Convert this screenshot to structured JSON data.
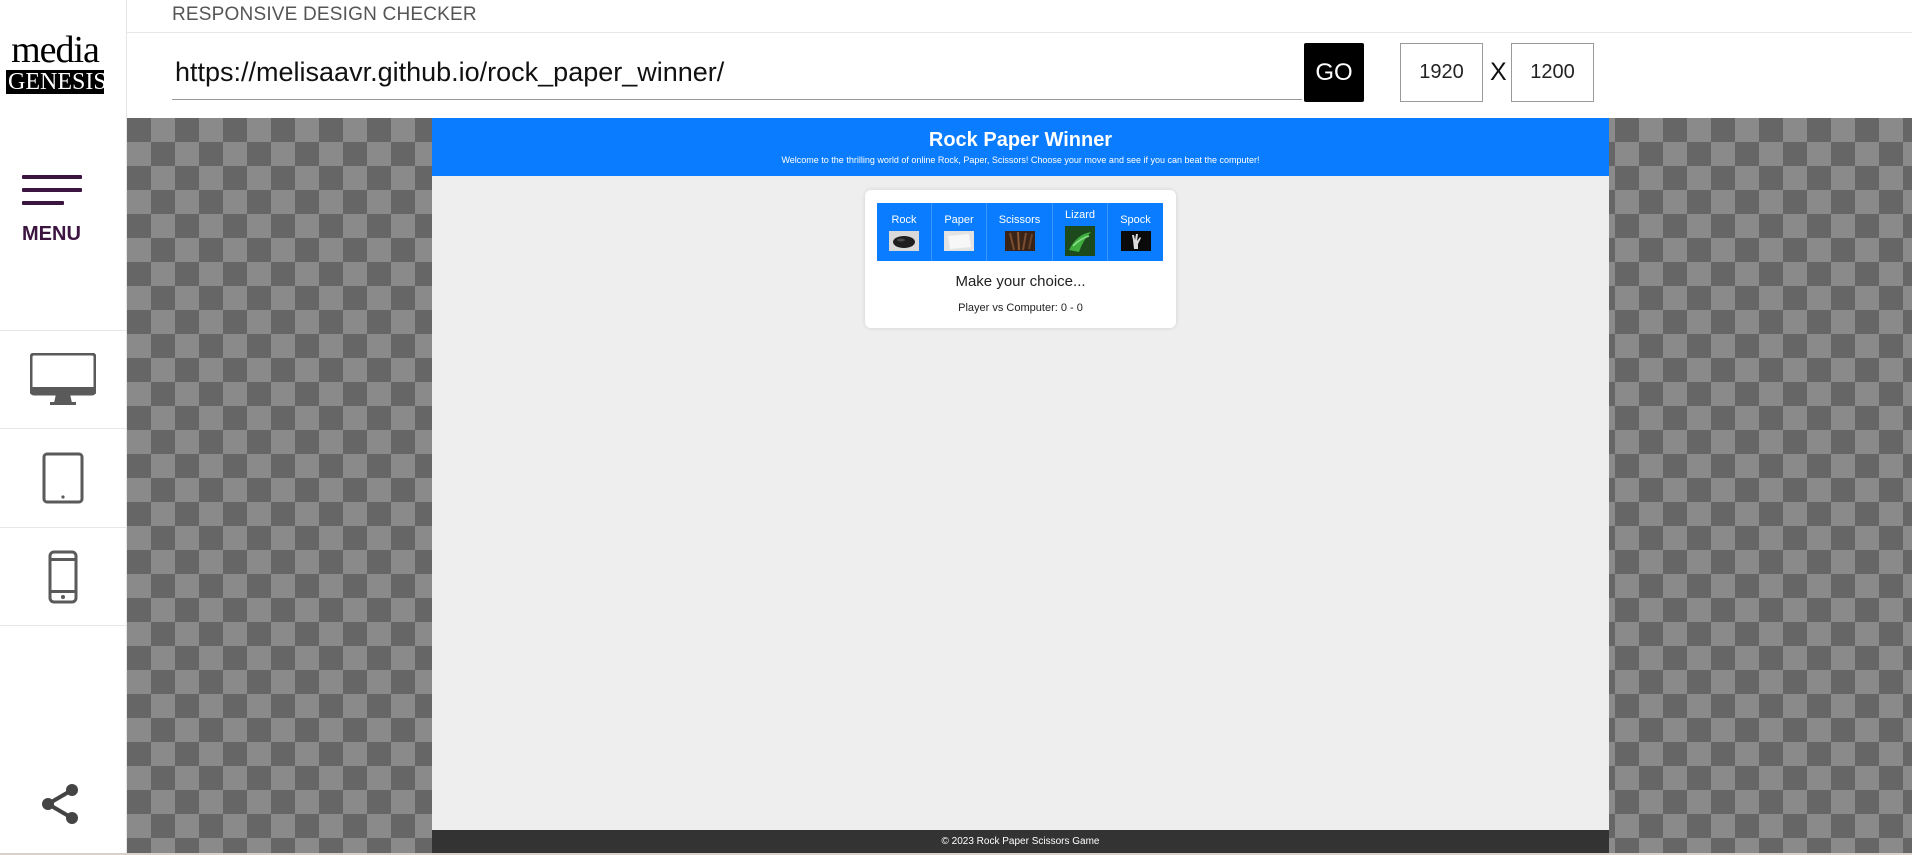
{
  "app": {
    "title": "RESPONSIVE DESIGN CHECKER"
  },
  "logo": {
    "line1": "media",
    "line2": "GENESIS"
  },
  "sidebar": {
    "menu_label": "MENU",
    "devices": [
      {
        "icon": "desktop-icon"
      },
      {
        "icon": "tablet-icon"
      },
      {
        "icon": "phone-icon"
      }
    ],
    "share_icon": "share-icon"
  },
  "toolbar": {
    "url": "https://melisaavr.github.io/rock_paper_winner/",
    "go_label": "GO",
    "width": "1920",
    "x_label": "X",
    "height": "1200"
  },
  "site": {
    "title": "Rock Paper Winner",
    "subtitle": "Welcome to the thrilling world of online Rock, Paper, Scissors! Choose your move and see if you can beat the computer!",
    "choices": [
      {
        "label": "Rock"
      },
      {
        "label": "Paper"
      },
      {
        "label": "Scissors"
      },
      {
        "label": "Lizard"
      },
      {
        "label": "Spock"
      }
    ],
    "prompt": "Make your choice...",
    "score": "Player vs Computer: 0 - 0",
    "footer": "© 2023 Rock Paper Scissors Game"
  },
  "colors": {
    "accent": "#0a7cff",
    "menu": "#3b1440",
    "footer": "#333333",
    "page_bg": "#eeeeee"
  }
}
